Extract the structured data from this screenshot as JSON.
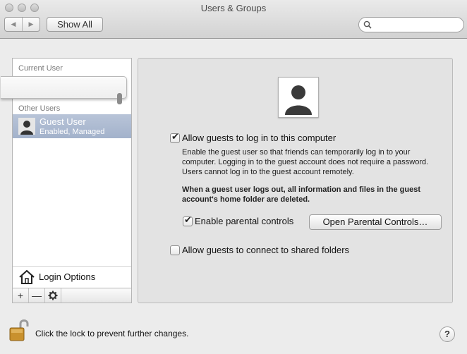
{
  "window": {
    "title": "Users & Groups"
  },
  "toolbar": {
    "back_glyph": "◀",
    "forward_glyph": "▶",
    "show_all_label": "Show All",
    "search_placeholder": ""
  },
  "sidebar": {
    "current_user_header": "Current User",
    "other_users_header": "Other Users",
    "users": [
      {
        "name": "Guest User",
        "status": "Enabled, Managed",
        "selected": true
      }
    ],
    "login_options_label": "Login Options",
    "buttons": {
      "add": "+",
      "remove": "—",
      "action": "✱"
    }
  },
  "main": {
    "allow_guest": {
      "label": "Allow guests to log in to this computer",
      "checked": true
    },
    "description": "Enable the guest user so that friends can temporarily log in to your computer. Logging in to the guest account does not require a password. Users cannot log in to the guest account remotely.",
    "note": "When a guest user logs out, all information and files in the guest account's home folder are deleted.",
    "parental_controls": {
      "label": "Enable parental controls",
      "checked": true
    },
    "open_parental_controls_label": "Open Parental Controls…",
    "shared_folders": {
      "label": "Allow guests to connect to shared folders",
      "checked": false
    }
  },
  "footer": {
    "lock_text": "Click the lock to prevent further changes.",
    "help_label": "?"
  },
  "colors": {
    "selection": "#a9b7cf",
    "window_bg": "#ececec",
    "panel_bg": "#e3e3e3",
    "lock_gold": "#c9912e"
  }
}
